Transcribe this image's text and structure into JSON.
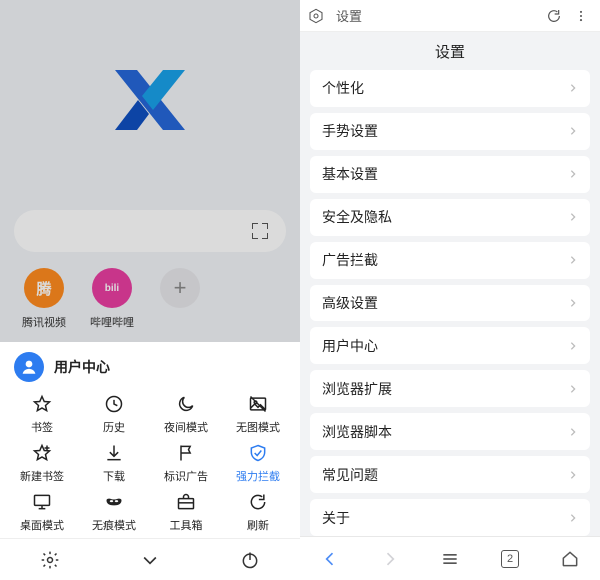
{
  "left": {
    "speed_dials": [
      {
        "label": "腾讯视频",
        "icon_text": "腾",
        "kind": "orange"
      },
      {
        "label": "哔哩哔哩",
        "icon_text": "bili",
        "kind": "pink"
      },
      {
        "label": "",
        "icon_text": "+",
        "kind": "add"
      }
    ],
    "user_center_title": "用户中心",
    "menu": [
      {
        "label": "书签",
        "icon": "star"
      },
      {
        "label": "历史",
        "icon": "history"
      },
      {
        "label": "夜间模式",
        "icon": "moon"
      },
      {
        "label": "无图模式",
        "icon": "noimg"
      },
      {
        "label": "新建书签",
        "icon": "star-plus"
      },
      {
        "label": "下载",
        "icon": "download"
      },
      {
        "label": "标识广告",
        "icon": "flag"
      },
      {
        "label": "强力拦截",
        "icon": "shield",
        "blue": true
      },
      {
        "label": "桌面模式",
        "icon": "desktop"
      },
      {
        "label": "无痕模式",
        "icon": "mask"
      },
      {
        "label": "工具箱",
        "icon": "toolbox"
      },
      {
        "label": "刷新",
        "icon": "reload"
      }
    ],
    "sheet_bar_icons": [
      "settings",
      "collapse",
      "power"
    ]
  },
  "right": {
    "url_label": "设置",
    "page_title": "设置",
    "items": [
      "个性化",
      "手势设置",
      "基本设置",
      "安全及隐私",
      "广告拦截",
      "高级设置",
      "用户中心",
      "浏览器扩展",
      "浏览器脚本",
      "常见问题",
      "关于"
    ],
    "tab_count": "2"
  }
}
